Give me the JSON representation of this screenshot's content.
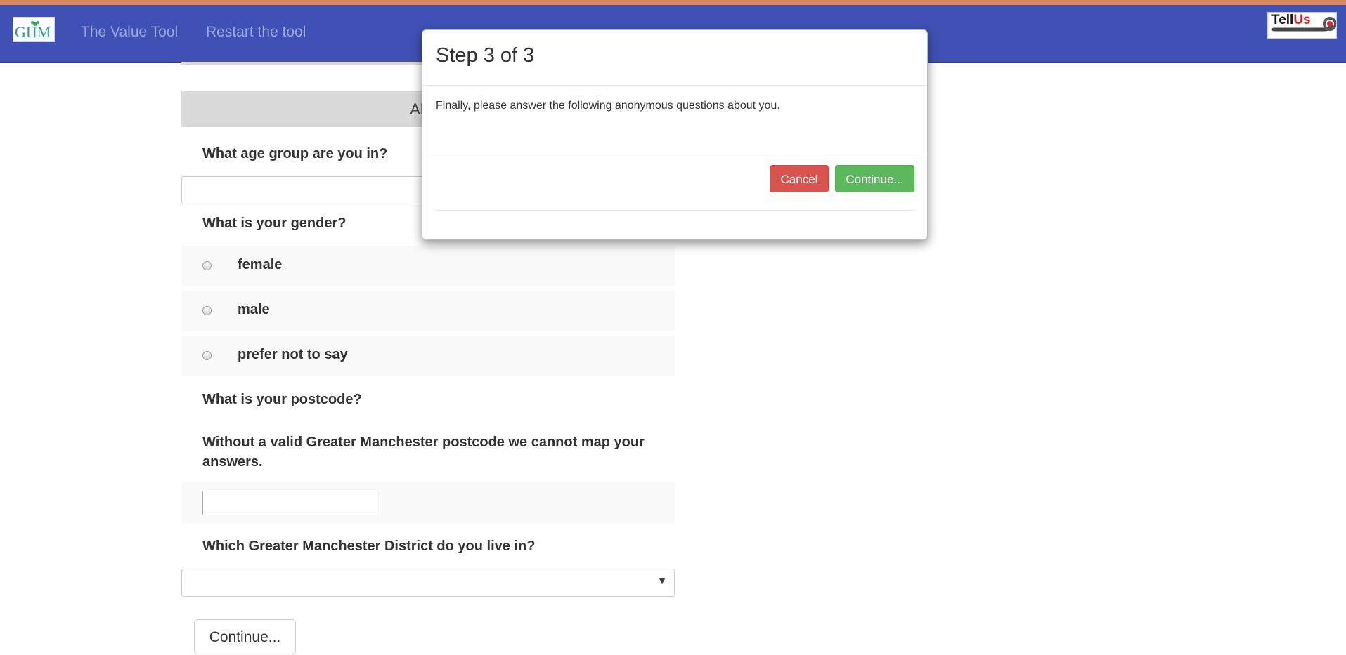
{
  "navbar": {
    "logo_ghm": "GHM",
    "links": [
      "The Value Tool",
      "Restart the tool"
    ],
    "logo_tellus": {
      "part1": "Tell",
      "part2": "Us",
      "sub": "toolkit"
    }
  },
  "form": {
    "section_heading": "Abou",
    "q_age": "What age group are you in?",
    "q_gender": "What is your gender?",
    "gender_options": [
      "female",
      "male",
      "prefer not to say"
    ],
    "q_postcode": "What is your postcode?",
    "postcode_note": "Without a valid Greater Manchester postcode we cannot map your answers.",
    "postcode_value": "",
    "q_district": "Which Greater Manchester District do you live in?",
    "district_selected": "",
    "continue_label": "Continue..."
  },
  "modal": {
    "title": "Step 3 of 3",
    "body": "Finally, please answer the following anonymous questions about you.",
    "cancel_label": "Cancel",
    "continue_label": "Continue..."
  },
  "colors": {
    "navbar": "#3f51b5",
    "cancel": "#d9534f",
    "continue": "#5cb85c"
  }
}
